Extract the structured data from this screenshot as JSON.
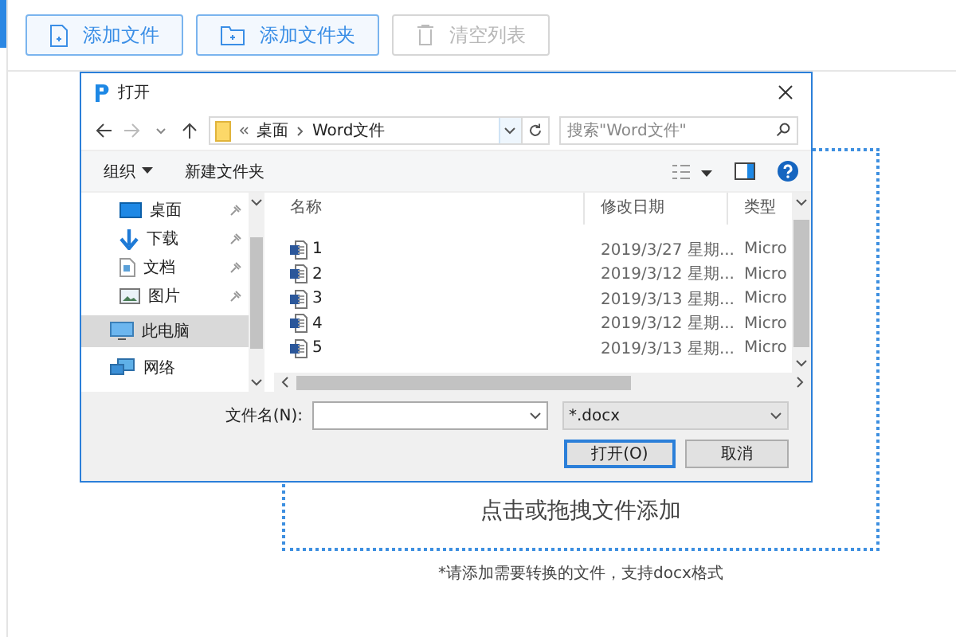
{
  "toolbar": {
    "buttons": [
      {
        "label": "添加文件",
        "kind": "file",
        "disabled": false
      },
      {
        "label": "添加文件夹",
        "kind": "folder",
        "disabled": false
      },
      {
        "label": "清空列表",
        "kind": "trash",
        "disabled": true
      }
    ]
  },
  "drop_zone": {
    "label": "点击或拖拽文件添加",
    "hint": "*请添加需要转换的文件，支持docx格式"
  },
  "dialog": {
    "title": "打开",
    "breadcrumb": [
      "桌面",
      "Word文件"
    ],
    "search": {
      "placeholder": "搜索\"Word文件\""
    },
    "commands": [
      {
        "label": "组织",
        "kind": "menu"
      },
      {
        "label": "新建文件夹",
        "kind": "action"
      }
    ],
    "nav": [
      {
        "label": "桌面",
        "kind": "desktop",
        "pinned": true,
        "selected": false
      },
      {
        "label": "下载",
        "kind": "download",
        "pinned": true,
        "selected": false
      },
      {
        "label": "文档",
        "kind": "document",
        "pinned": true,
        "selected": false
      },
      {
        "label": "图片",
        "kind": "picture",
        "pinned": true,
        "selected": false
      },
      {
        "label": "此电脑",
        "kind": "computer",
        "pinned": false,
        "selected": true
      },
      {
        "label": "网络",
        "kind": "network",
        "pinned": false,
        "selected": false
      }
    ],
    "columns": [
      "名称",
      "修改日期",
      "类型"
    ],
    "files": [
      {
        "name": "1",
        "date": "2019/3/27 星期...",
        "type": "Micro"
      },
      {
        "name": "2",
        "date": "2019/3/12 星期...",
        "type": "Micro"
      },
      {
        "name": "3",
        "date": "2019/3/13 星期...",
        "type": "Micro"
      },
      {
        "name": "4",
        "date": "2019/3/12 星期...",
        "type": "Micro"
      },
      {
        "name": "5",
        "date": "2019/3/13 星期...",
        "type": "Micro"
      }
    ],
    "filename_label": "文件名(N):",
    "filter": "*.docx",
    "buttons": [
      {
        "label": "打开(O)",
        "default": true
      },
      {
        "label": "取消",
        "default": false
      }
    ]
  }
}
